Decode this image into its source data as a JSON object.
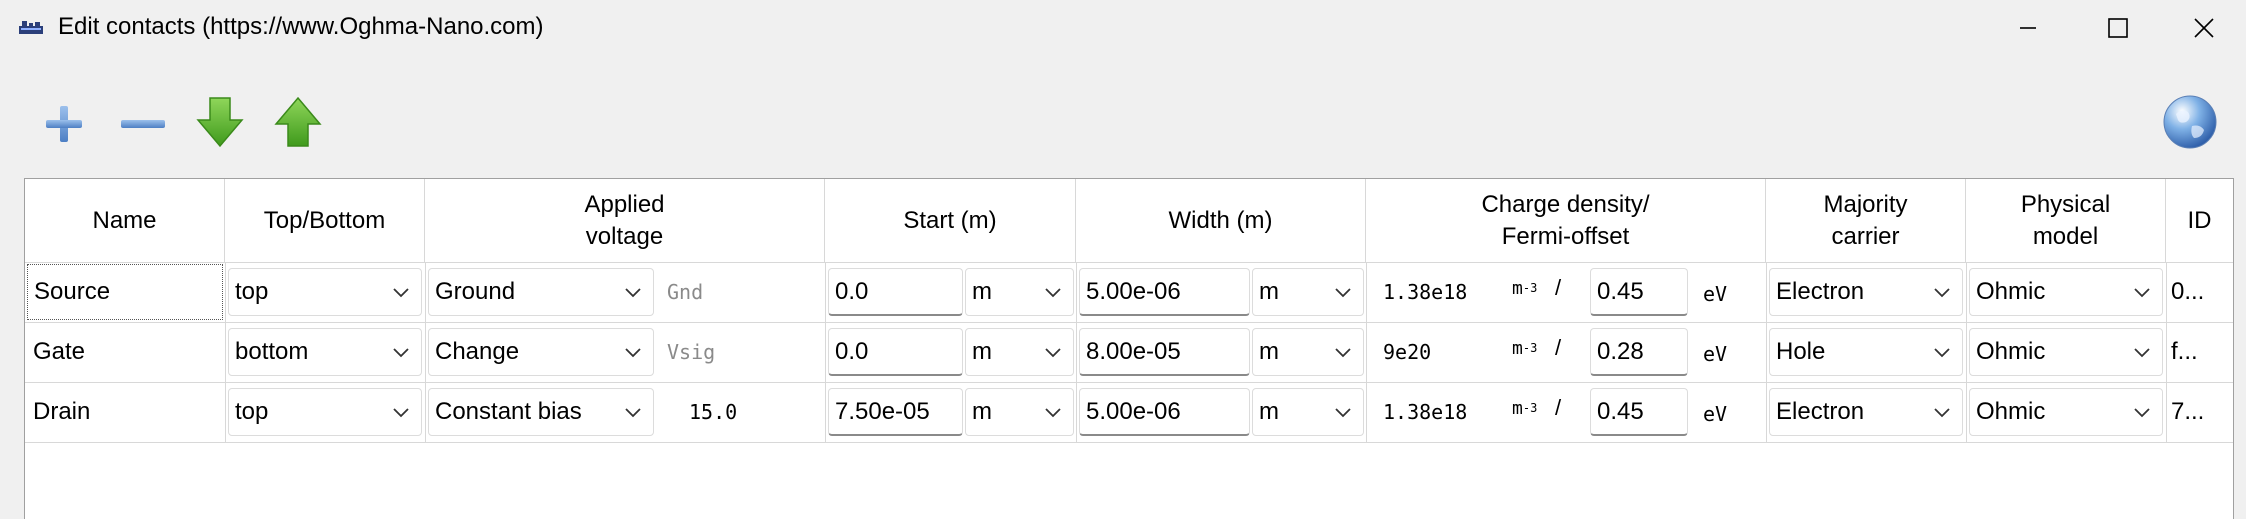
{
  "window": {
    "title": "Edit contacts (https://www.Oghma-Nano.com)"
  },
  "toolbar": {
    "add_icon": "plus-icon",
    "remove_icon": "minus-icon",
    "down_icon": "arrow-down-icon",
    "up_icon": "arrow-up-icon",
    "globe_icon": "globe-icon"
  },
  "table": {
    "headers": {
      "name": "Name",
      "top_bottom": "Top/Bottom",
      "applied_voltage": "Applied\nvoltage",
      "start": "Start (m)",
      "width": "Width (m)",
      "charge_density": "Charge density/\nFermi-offset",
      "majority_carrier": "Majority\ncarrier",
      "physical_model": "Physical\nmodel",
      "id": "ID"
    },
    "rows": [
      {
        "name": "Source",
        "position": "top",
        "voltage_type": "Ground",
        "voltage_value": "Gnd",
        "start": "0.0",
        "start_unit": "m",
        "width": "5.00e-06",
        "width_unit": "m",
        "charge_density": "1.38e18",
        "cd_unit": "m",
        "cd_unit_exp": "-3",
        "slash": "/",
        "fermi_offset": "0.45",
        "fermi_unit": "eV",
        "majority_carrier": "Electron",
        "physical_model": "Ohmic",
        "id": "0..."
      },
      {
        "name": "Gate",
        "position": "bottom",
        "voltage_type": "Change",
        "voltage_value": "Vsig",
        "start": "0.0",
        "start_unit": "m",
        "width": "8.00e-05",
        "width_unit": "m",
        "charge_density": "9e20",
        "cd_unit": "m",
        "cd_unit_exp": "-3",
        "slash": "/",
        "fermi_offset": "0.28",
        "fermi_unit": "eV",
        "majority_carrier": "Hole",
        "physical_model": "Ohmic",
        "id": "f..."
      },
      {
        "name": "Drain",
        "position": "top",
        "voltage_type": "Constant bias",
        "voltage_value": "15.0",
        "start": "7.50e-05",
        "start_unit": "m",
        "width": "5.00e-06",
        "width_unit": "m",
        "charge_density": "1.38e18",
        "cd_unit": "m",
        "cd_unit_exp": "-3",
        "slash": "/",
        "fermi_offset": "0.45",
        "fermi_unit": "eV",
        "majority_carrier": "Electron",
        "physical_model": "Ohmic",
        "id": "7..."
      }
    ]
  },
  "colors": {
    "accent_blue": "#5b8fd0",
    "arrow_green": "#5cb82e",
    "window_bg": "#f0f0f0"
  }
}
